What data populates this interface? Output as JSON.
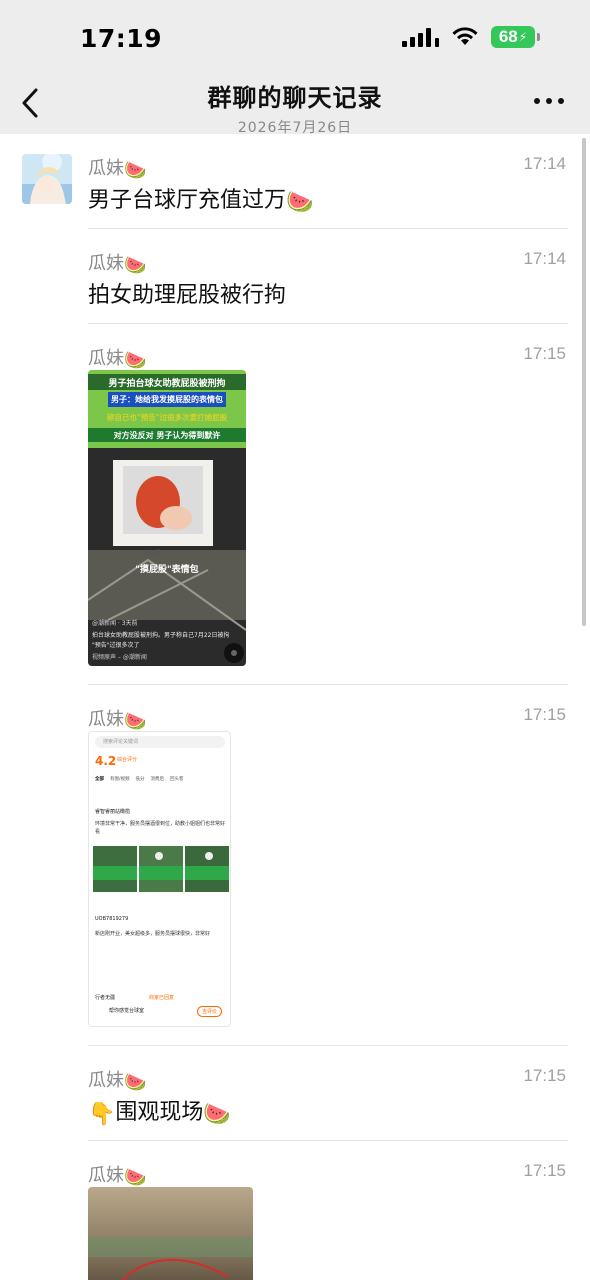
{
  "status": {
    "time": "17:19",
    "battery": "68"
  },
  "header": {
    "title": "群聊的聊天记录",
    "date": "2026年7月26日"
  },
  "messages": [
    {
      "sender": "瓜妹",
      "time": "17:14",
      "text": "男子台球厅充值过万"
    },
    {
      "sender": "瓜妹",
      "time": "17:14",
      "text": "拍女助理屁股被行拘"
    },
    {
      "sender": "瓜妹",
      "time": "17:15",
      "image": {
        "line1": "男子拍台球女助教屁股被刑拘",
        "line2": "男子：她给我发摸屁股的表情包",
        "line3": "称自己也\"预告\"过很多次要打她屁股",
        "line4": "对方没反对 男子认为得到默许",
        "sticker_label": "摸屁股",
        "caption": "\"摸屁股\"表情包",
        "source": "@潮新闻 · 3天前",
        "desc": "拍台球女助教屁股被刑拘。男子称自己7月22日被拘",
        "desc2": "\"预告\"过很多次了",
        "music": "视频原声 – @潮新闻"
      }
    },
    {
      "sender": "瓜妹",
      "time": "17:15",
      "image": {
        "search": "搜索评论关键词",
        "rating": "4.2",
        "rating_label": "综合评分",
        "tabs": [
          "全部",
          "有图/视频",
          "低分",
          "消费后",
          "回头客"
        ],
        "r1_name": "睿智睿丽站橄榄",
        "r1_text": "环境非常干净，服务员摆酒很到位，助教小姐姐们也非常好看",
        "r2_name": "UOB7819279",
        "r2_text": "新店刚开业，美女超级多，服务员摆球很快，非常好",
        "footer_name": "行者无疆",
        "footer_text": "商家已回复",
        "cta": "吉评价",
        "bottom_title": "帮你感觉台球室"
      }
    },
    {
      "sender": "瓜妹",
      "time": "17:15",
      "text": "围观现场"
    },
    {
      "sender": "瓜妹",
      "time": "17:15"
    }
  ],
  "colors": {
    "header_bg": "#ededed",
    "battery": "#34c759",
    "divider": "#e4e4e4"
  }
}
